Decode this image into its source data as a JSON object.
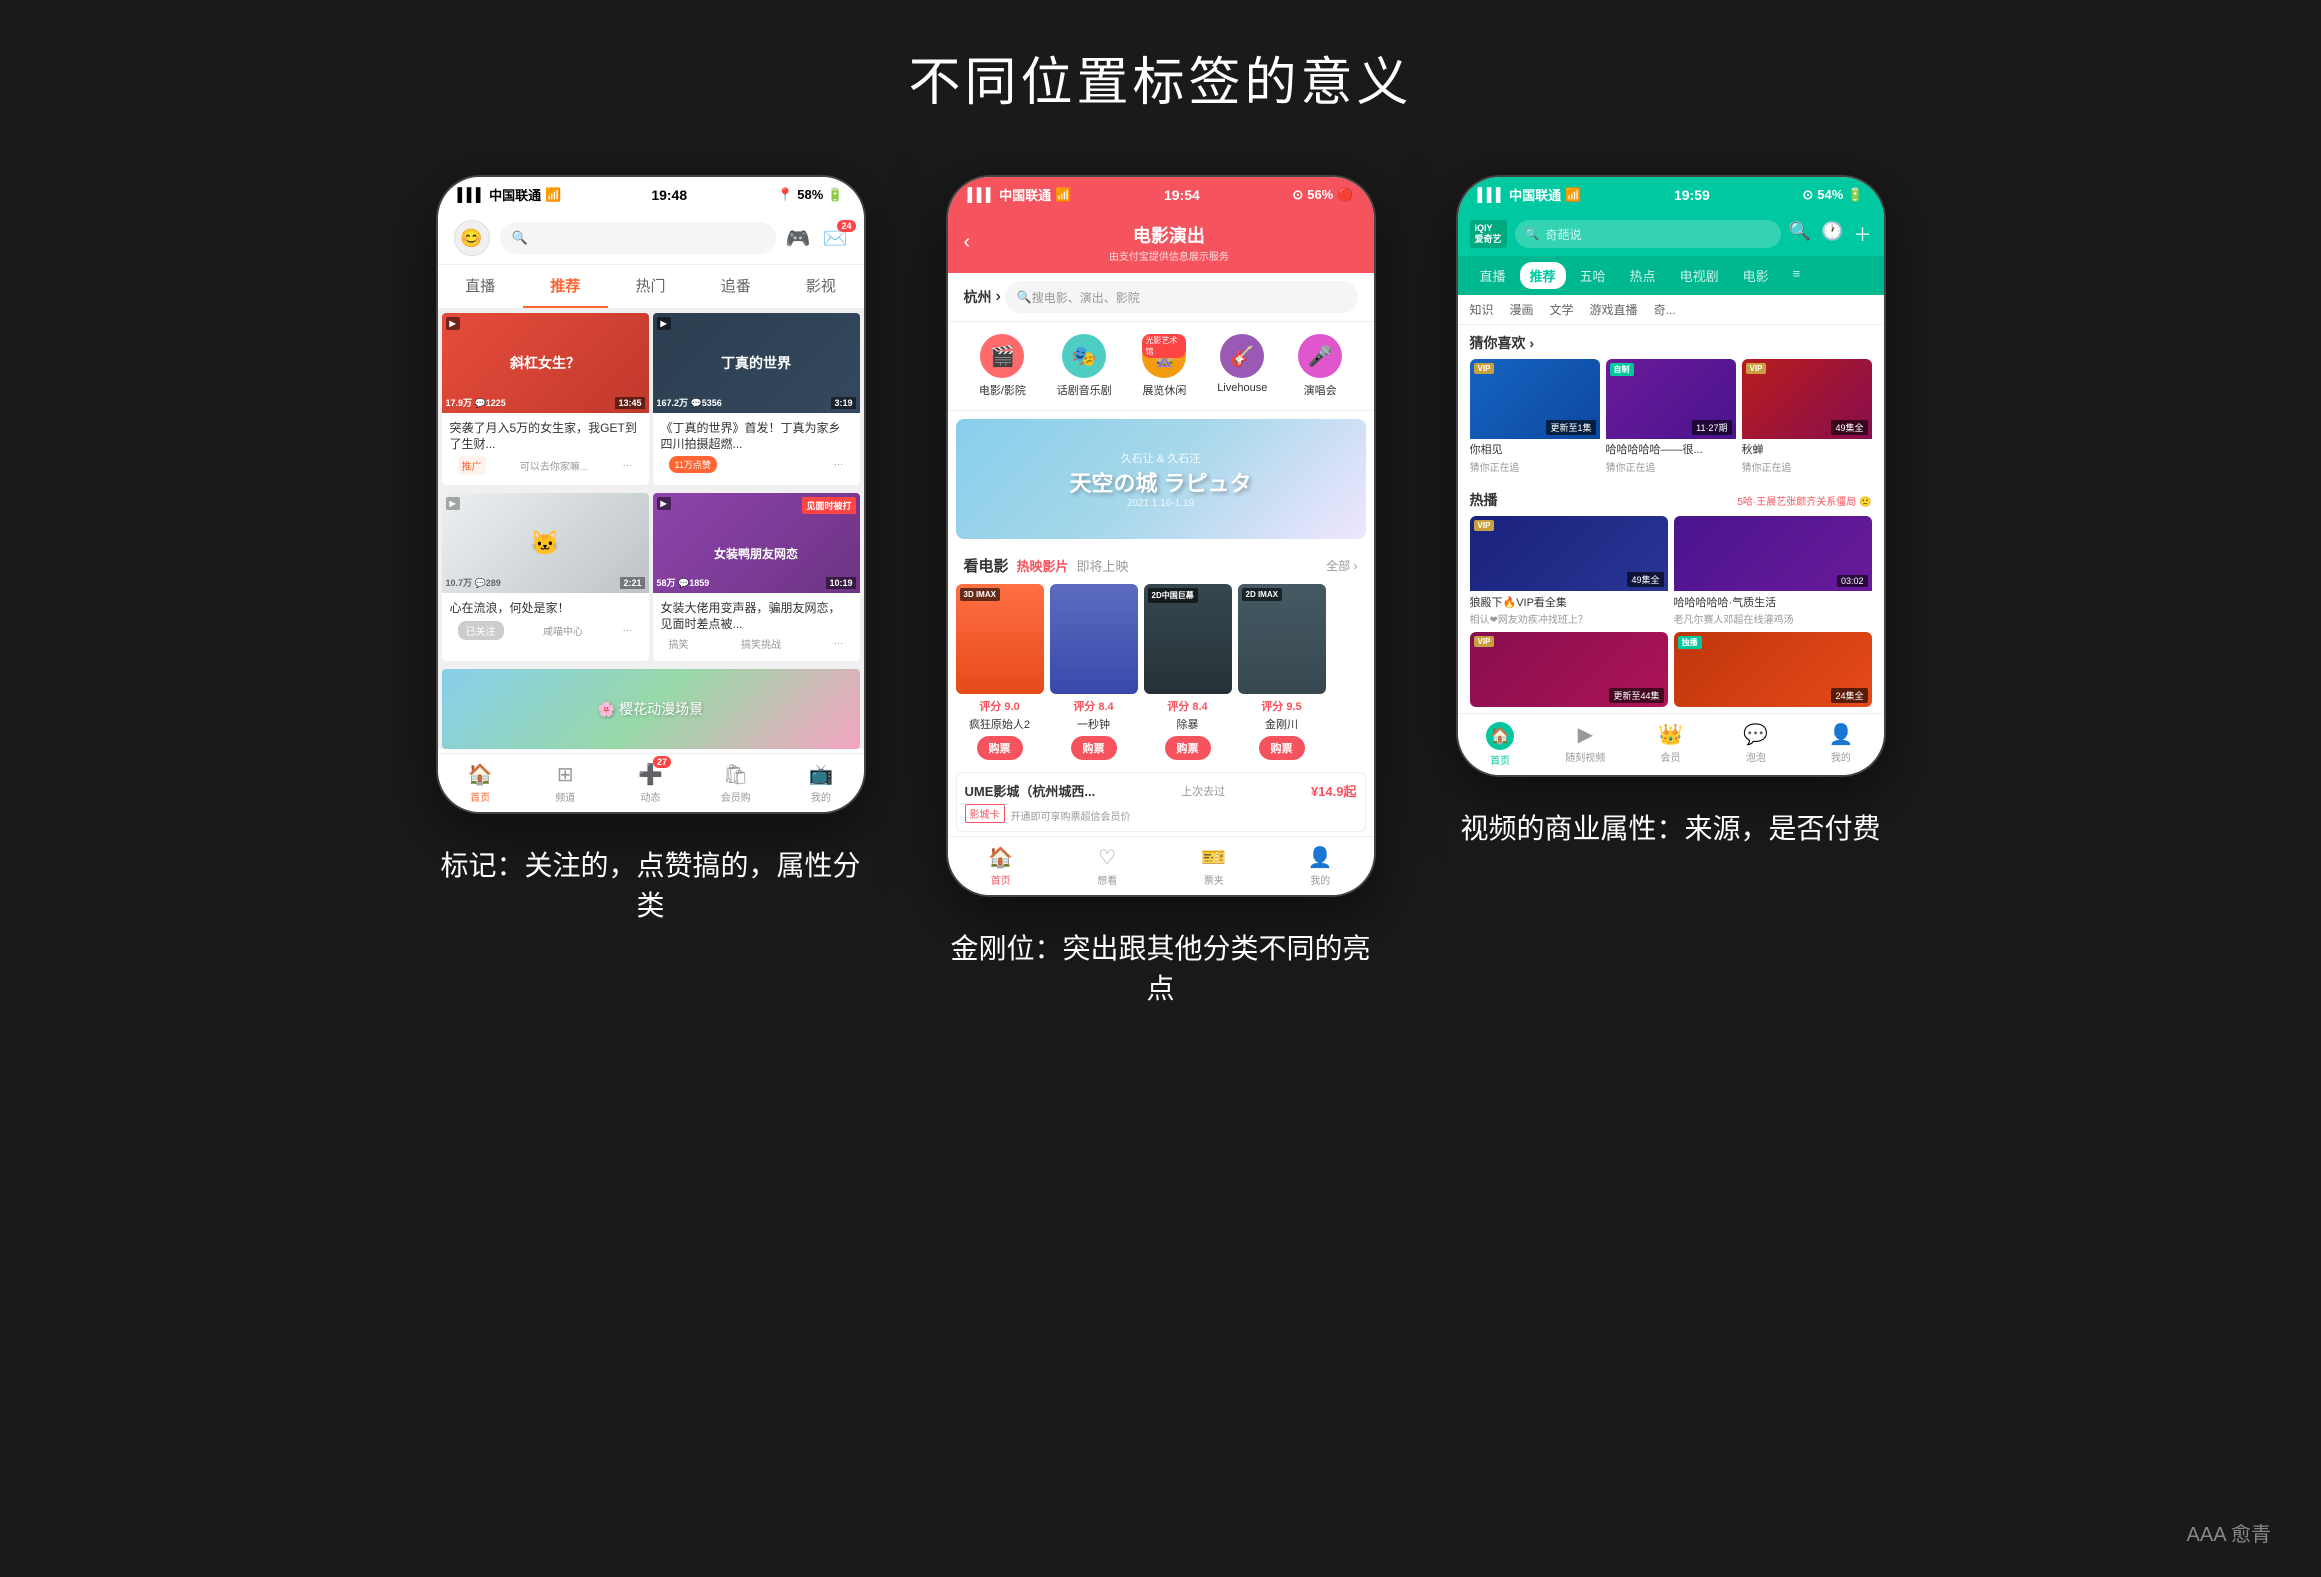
{
  "page": {
    "title": "不同位置标签的意义",
    "bg_color": "#1a1a1a"
  },
  "phone1": {
    "caption": "标记：关注的，点赞搞的，属性分类",
    "status": {
      "carrier": "中国联通",
      "time": "19:48",
      "battery": "58%"
    },
    "tabs": [
      "直播",
      "推荐",
      "热门",
      "追番",
      "影视"
    ],
    "active_tab": "推荐",
    "videos": [
      {
        "title": "突袭了月入5万的女生家，我GET到了生财...",
        "views": "17.9万",
        "comments": "1225",
        "duration": "13:45",
        "tag": "推广",
        "action_text": "可以去你家嘛..."
      },
      {
        "title": "《丁真的世界》首发！丁真为家乡四川拍摄超燃...",
        "views": "167.2万",
        "comments": "5356",
        "duration": "3:19",
        "tag": "11万点赞"
      },
      {
        "title": "心在流浪，何处是家！",
        "views": "10.7万",
        "comments": "289",
        "duration": "2:21",
        "follow_status": "已关注",
        "channel": "咸喵中心"
      },
      {
        "title": "女装大佬用变声器，骗朋友网恋，见面时差点被...",
        "views": "58万",
        "comments": "1859",
        "duration": "10:19",
        "tag": "见面时被打",
        "channel": "搞笑",
        "channel2": "搞笑挑战"
      }
    ],
    "tabbar": [
      "首页",
      "频道",
      "动态",
      "会员购",
      "我的"
    ],
    "active_tabbar": "首页",
    "dynamic_badge": "27"
  },
  "phone2": {
    "caption": "金刚位：突出跟其他分类不同的亮点",
    "status": {
      "carrier": "中国联通",
      "time": "19:54",
      "battery": "56%"
    },
    "header_title": "电影演出",
    "header_subtitle": "由支付宝提供信息展示服务",
    "location": "杭州",
    "search_placeholder": "搜电影、演出、影院",
    "categories": [
      {
        "name": "电影/影院",
        "icon": "🎬",
        "color": "#ff6b6b"
      },
      {
        "name": "话剧音乐剧",
        "icon": "🎭",
        "color": "#4ecdc4"
      },
      {
        "name": "展览休闲",
        "icon": "🎡",
        "color": "#f39c12",
        "badge": "光影艺术馆"
      },
      {
        "name": "Livehouse",
        "icon": "🎸",
        "color": "#9b59b6"
      },
      {
        "name": "演唱会",
        "icon": "🎤",
        "color": "#e056cd"
      }
    ],
    "banner_text": "天空の城 ラピュタ",
    "banner_sub": "久石让 & 久石汪",
    "section_title": "看电影",
    "section_tab1": "热映影片",
    "section_tab2": "即将上映",
    "section_link": "全部 ›",
    "movies": [
      {
        "title": "疯狂原始人2",
        "score": "评分 9.0",
        "badge": "3D IMAX",
        "color": "#ff7043"
      },
      {
        "title": "一秒钟",
        "score": "评分 8.4",
        "color": "#5c6bc0"
      },
      {
        "title": "除暴",
        "score": "评分 8.4",
        "badge": "2D中国巨幕",
        "color": "#37474f"
      },
      {
        "title": "金刚川",
        "score": "评分 9.5",
        "badge": "2D IMAX",
        "color": "#455a64"
      }
    ],
    "cinema": {
      "name": "UME影城（杭州城西...",
      "last_visit": "上次去过",
      "price": "¥14.9起",
      "card_tag": "影城卡",
      "info": "开通即可享购票超信会员价"
    },
    "tabbar": [
      "首页",
      "想看",
      "票夹",
      "我的"
    ],
    "active_tabbar": "首页"
  },
  "phone3": {
    "caption": "视频的商业属性：来源，是否付费",
    "status": {
      "carrier": "中国联通",
      "time": "19:59",
      "battery": "54%"
    },
    "logo_line1": "iQIY",
    "logo_line2": "爱奇艺",
    "search_placeholder": "奇葩说",
    "tabs": [
      "直播",
      "推荐",
      "五哈",
      "热点",
      "电视剧",
      "电影"
    ],
    "active_tab": "推荐",
    "subtabs": [
      "知识",
      "漫画",
      "文学",
      "游戏直播",
      "奇..."
    ],
    "recommend_title": "猜你喜欢 ›",
    "recommend_videos": [
      {
        "title": "你相见",
        "sub": "猜你正在追",
        "ep": "更新至1集",
        "badge": "VIP",
        "color": "#2c3e50"
      },
      {
        "title": "哈哈哈哈哈——很...",
        "sub": "猜你正在追",
        "ep": "11·27期",
        "color": "#8e44ad"
      },
      {
        "title": "秋蝉",
        "sub": "猜你正在追",
        "ep": "49集全",
        "badge": "VIP",
        "color": "#c0392b"
      }
    ],
    "hot_title": "热播",
    "hot_link": "5哈·王晨艺张颜齐关系僵局 🙂",
    "hot_videos": [
      {
        "title": "狼殿下🔥VIP看全集",
        "sub": "相认❤网友劝疾冲找班上？",
        "ep": "49集全",
        "badge": "VIP",
        "color": "#1a237e"
      },
      {
        "title": "哈哈哈哈哈·气质生活",
        "sub": "老凡尔赛人邓超在线灌鸡汤",
        "ep": "03:02",
        "color": "#4a148c"
      }
    ],
    "hot_videos2": [
      {
        "title": "",
        "sub": "",
        "ep": "更新至44集",
        "badge": "VIP",
        "color": "#880e4f"
      },
      {
        "title": "",
        "sub": "",
        "ep": "24集全",
        "badge": "独播",
        "color": "#e65100"
      }
    ],
    "tabbar": [
      "首页",
      "随刻视频",
      "会员",
      "泡泡",
      "我的"
    ],
    "active_tabbar": "首页"
  },
  "watermark": "AAA 愈青"
}
